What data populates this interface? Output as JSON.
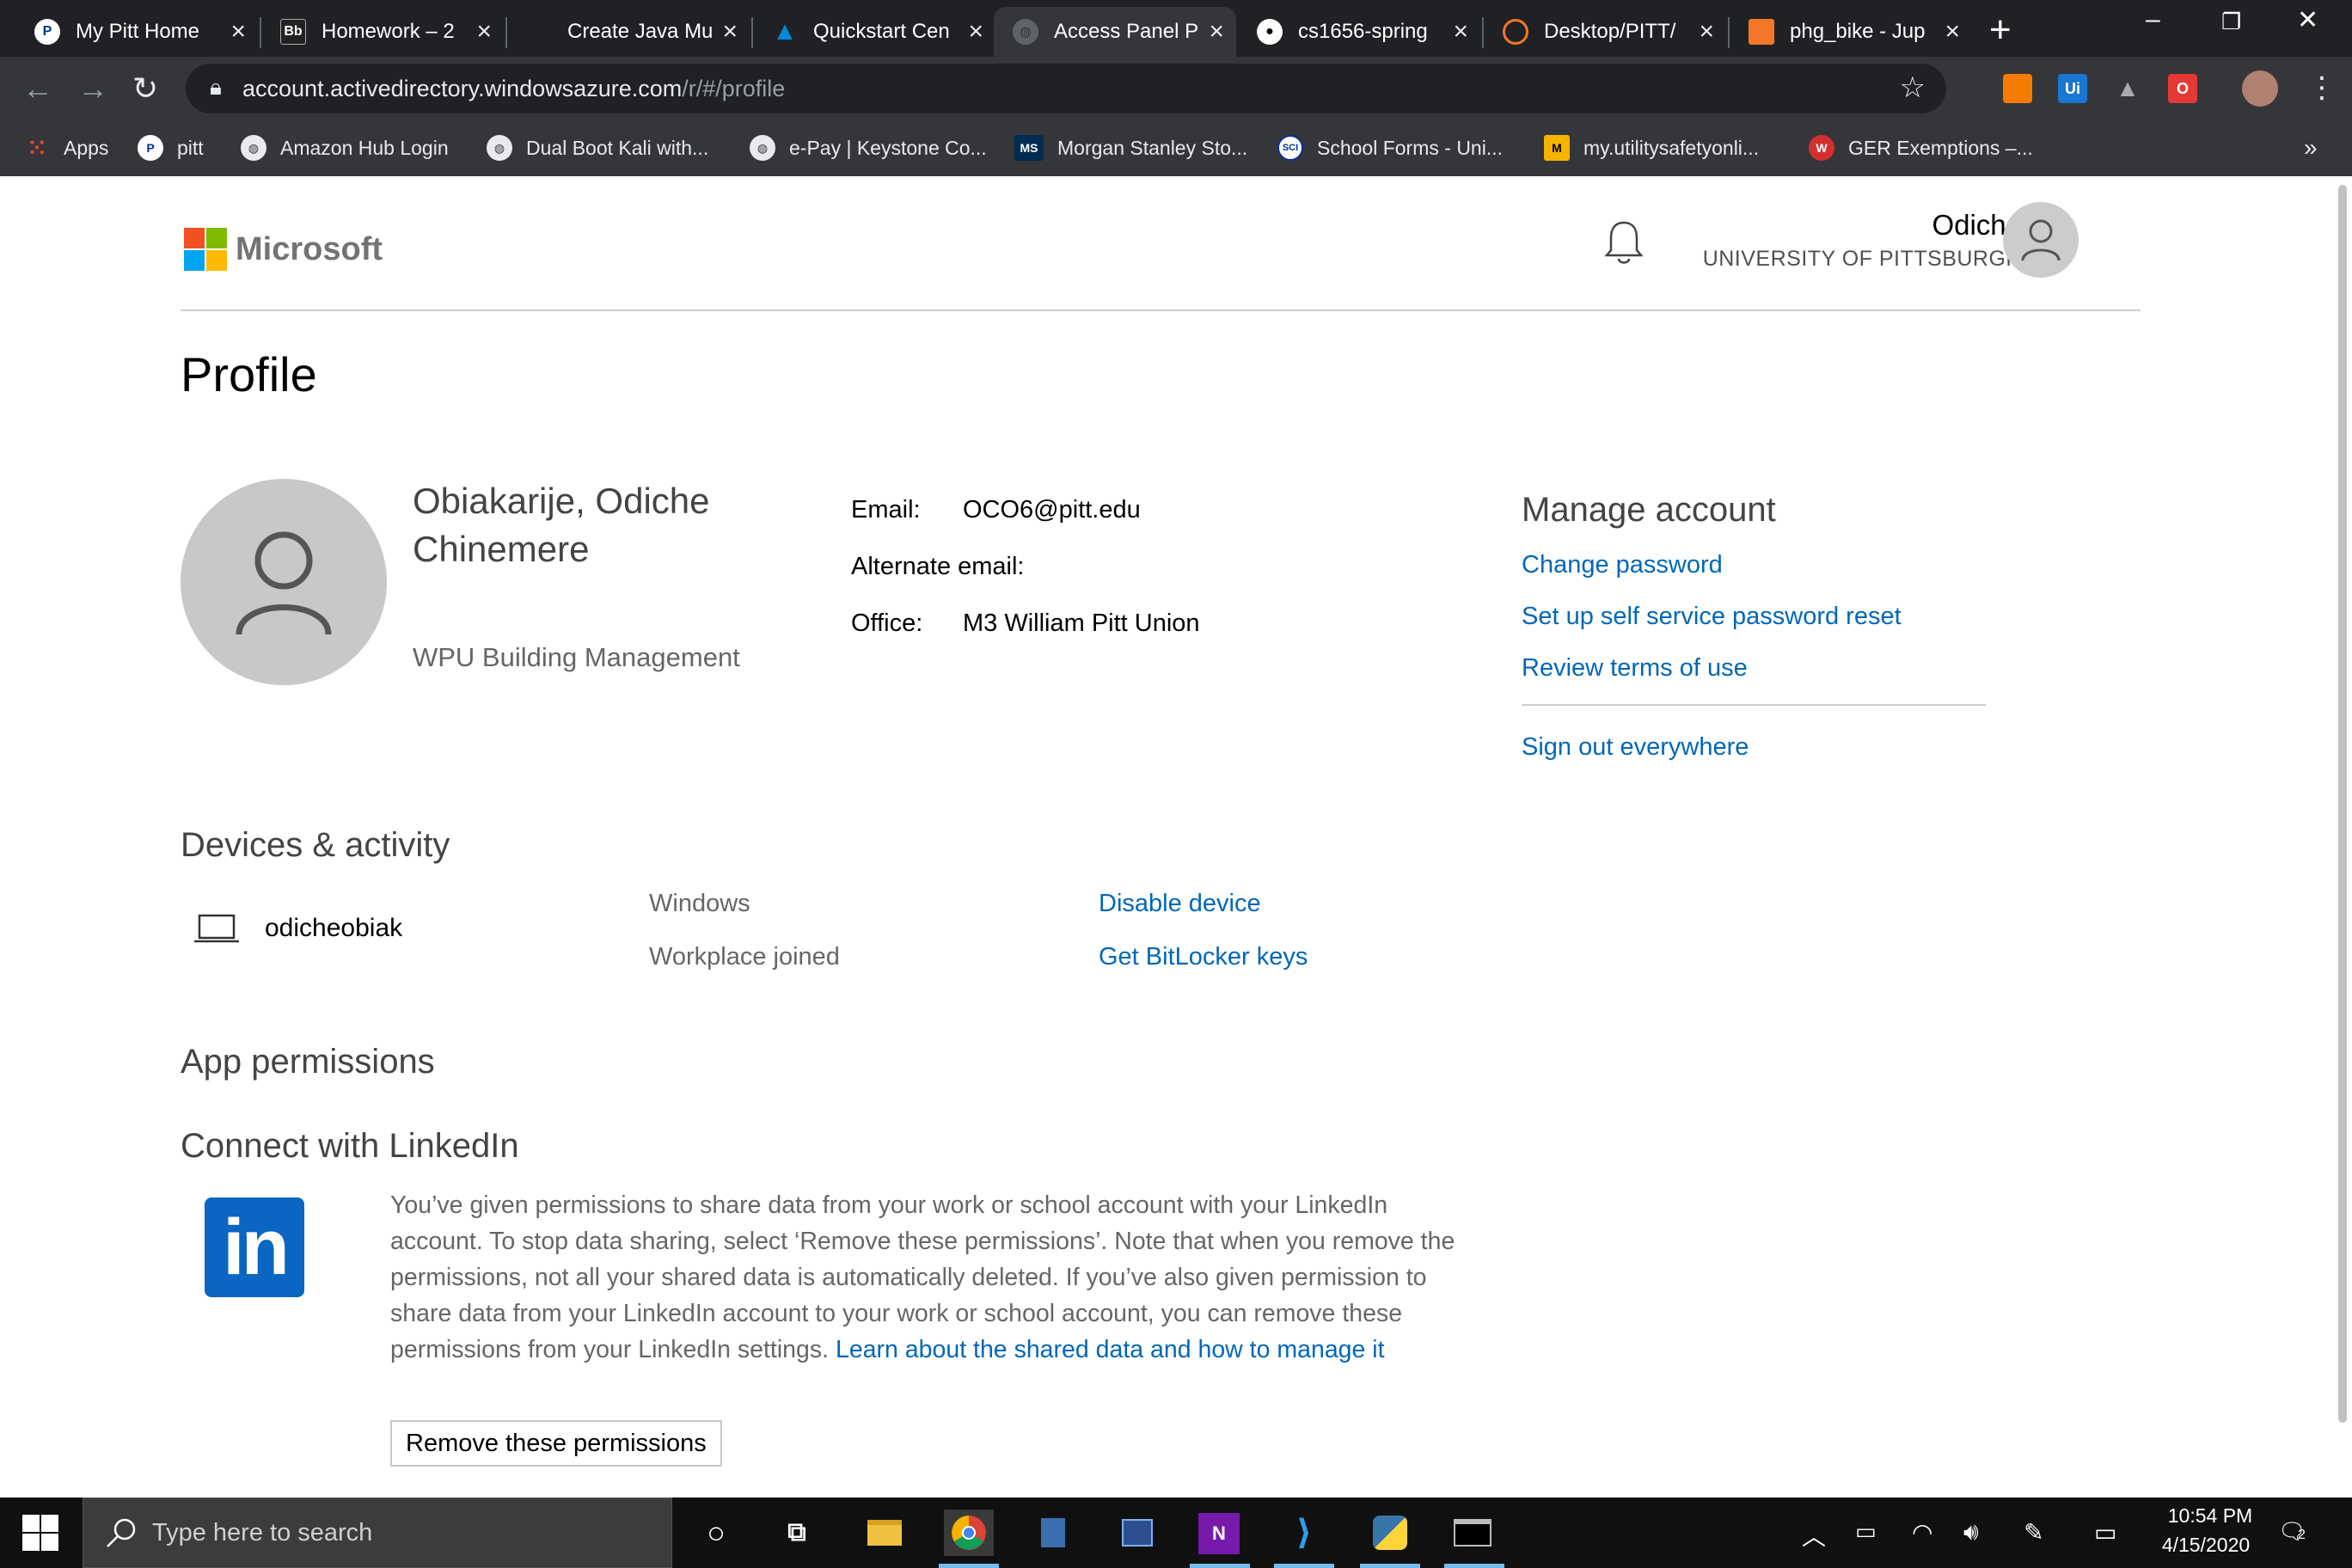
{
  "browser": {
    "tabs": [
      {
        "label": "My Pitt Home",
        "icon": "pitt-seal-icon"
      },
      {
        "label": "Homework – 2",
        "icon": "blackboard-icon"
      },
      {
        "label": "Create Java Mu",
        "icon": "windows-logo-icon"
      },
      {
        "label": "Quickstart Cen",
        "icon": "azure-icon"
      },
      {
        "label": "Access Panel P",
        "icon": "globe-icon",
        "active": true
      },
      {
        "label": "cs1656-spring",
        "icon": "github-icon"
      },
      {
        "label": "Desktop/PITT/",
        "icon": "jupyter-icon"
      },
      {
        "label": "phg_bike - Jup",
        "icon": "notebook-icon"
      }
    ],
    "url_main": "account.activedirectory.windowsazure.com",
    "url_path": "/r/#/profile",
    "bookmarks": [
      {
        "label": "Apps",
        "icon": "apps-grid-icon"
      },
      {
        "label": "pitt",
        "icon": "pitt-seal-icon"
      },
      {
        "label": "Amazon Hub Login",
        "icon": "globe-icon"
      },
      {
        "label": "Dual Boot Kali with...",
        "icon": "globe-icon"
      },
      {
        "label": "e-Pay | Keystone Co...",
        "icon": "globe-icon"
      },
      {
        "label": "Morgan Stanley Sto...",
        "icon": "ms-icon"
      },
      {
        "label": "School Forms - Uni...",
        "icon": "sci-icon"
      },
      {
        "label": "my.utilitysafetyonli...",
        "icon": "m-logo-icon"
      },
      {
        "label": "GER Exemptions –...",
        "icon": "w-logo-icon"
      }
    ],
    "bookmarks_overflow": "»",
    "ext_ui": "Ui"
  },
  "header": {
    "brand": "Microsoft",
    "user_name": "Odiche",
    "user_org": "UNIVERSITY OF PITTSBURGH"
  },
  "profile": {
    "title": "Profile",
    "name": "Obiakarije, Odiche Chinemere",
    "department": "WPU Building Management",
    "email_label": "Email:",
    "email_value": "OCO6@pitt.edu",
    "alt_email_label": "Alternate email:",
    "office_label": "Office:",
    "office_value": "M3 William Pitt Union"
  },
  "manage": {
    "title": "Manage account",
    "change_password": "Change password",
    "sspr": "Set up self service password reset",
    "terms": "Review terms of use",
    "sign_out": "Sign out everywhere"
  },
  "devices": {
    "title": "Devices & activity",
    "device_name": "odicheobiak",
    "os": "Windows",
    "join_type": "Workplace joined",
    "disable": "Disable device",
    "bitlocker": "Get BitLocker keys"
  },
  "apps": {
    "title": "App permissions",
    "linkedin_title": "Connect with LinkedIn",
    "linkedin_body": "You’ve given permissions to share data from your work or school account with your LinkedIn account. To stop data sharing, select ‘Remove these permissions’. Note that when you remove the permissions, not all your shared data is automatically deleted. If you’ve also given permission to share data from your LinkedIn account to your work or school account, you can remove these permissions from your LinkedIn settings.",
    "learn_link": "Learn about the shared data and how to manage it",
    "remove_button": "Remove these permissions"
  },
  "taskbar": {
    "search_placeholder": "Type here to search",
    "time": "10:54 PM",
    "date": "4/15/2020",
    "notification_count": "2"
  },
  "colors": {
    "link": "#0067b8",
    "linkedin": "#0a66c2",
    "chrome_bg": "#202124"
  }
}
